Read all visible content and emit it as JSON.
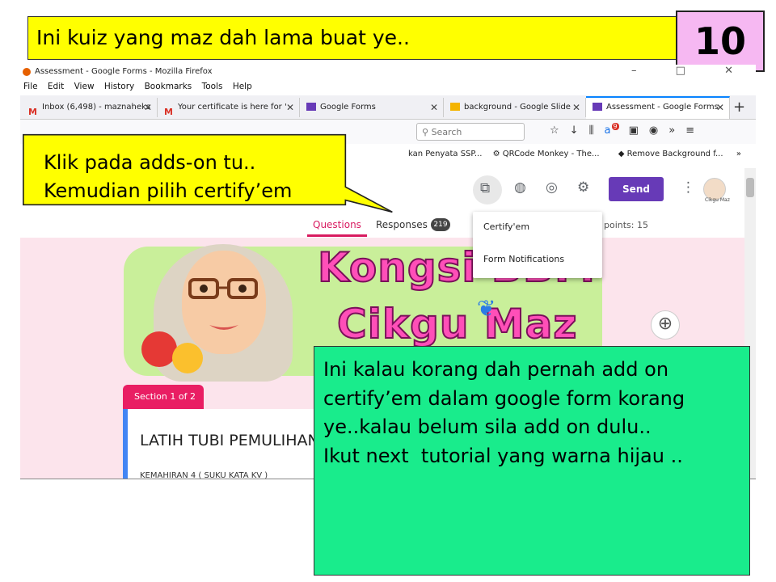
{
  "slide": {
    "title": "Ini kuiz yang maz dah lama buat ye..",
    "number": "10"
  },
  "browser": {
    "window_title": "Assessment - Google Forms - Mozilla Firefox",
    "window_controls": "–  □  ✕",
    "menu": [
      "File",
      "Edit",
      "View",
      "History",
      "Bookmarks",
      "Tools",
      "Help"
    ],
    "tabs": [
      {
        "label": "Inbox (6,498) - maznaheks",
        "icon": "gmail-icon"
      },
      {
        "label": "Your certificate is here for '",
        "icon": "gmail-icon"
      },
      {
        "label": "Google Forms",
        "icon": "forms-icon"
      },
      {
        "label": "background - Google Slide",
        "icon": "slides-icon"
      },
      {
        "label": "Assessment - Google Forms",
        "icon": "forms-icon",
        "active": true
      }
    ],
    "new_tab": "+",
    "search_placeholder": "Search",
    "toolbar_badge": "9",
    "bookmarks": [
      "kan Penyata SSP...",
      "QRCode Monkey - The...",
      "Remove Background f..."
    ],
    "bookmarks_more": "»"
  },
  "forms": {
    "send_label": "Send",
    "avatar_label": "Cikgu Maz",
    "tab_questions": "Questions",
    "tab_responses": "Responses",
    "responses_count": "219",
    "points": "points: 15",
    "dropdown": {
      "item1": "Certify'em",
      "item2": "Form Notifications"
    },
    "banner_line1": "Kongsi BBM",
    "banner_line2": "Cikgu Maz",
    "section_tab": "Section 1 of 2",
    "form_title": "LATIH TUBI PEMULIHAN",
    "form_subtitle": "KEMAHIRAN 4 ( SUKU KATA KV )"
  },
  "callouts": {
    "yellow_line1": "Klik pada adds-on tu..",
    "yellow_line2": "Kemudian pilih certify’em",
    "green_text": "Ini kalau korang dah pernah add on certify’em dalam google form korang ye..kalau belum sila add on dulu..\nIkut next  tutorial yang warna hijau .."
  },
  "colors": {
    "title_bg": "#ffff00",
    "number_bg": "#f6b8f2",
    "callout_green": "#19ec8c",
    "forms_purple": "#673ab7",
    "forms_pink": "#e91e63"
  }
}
